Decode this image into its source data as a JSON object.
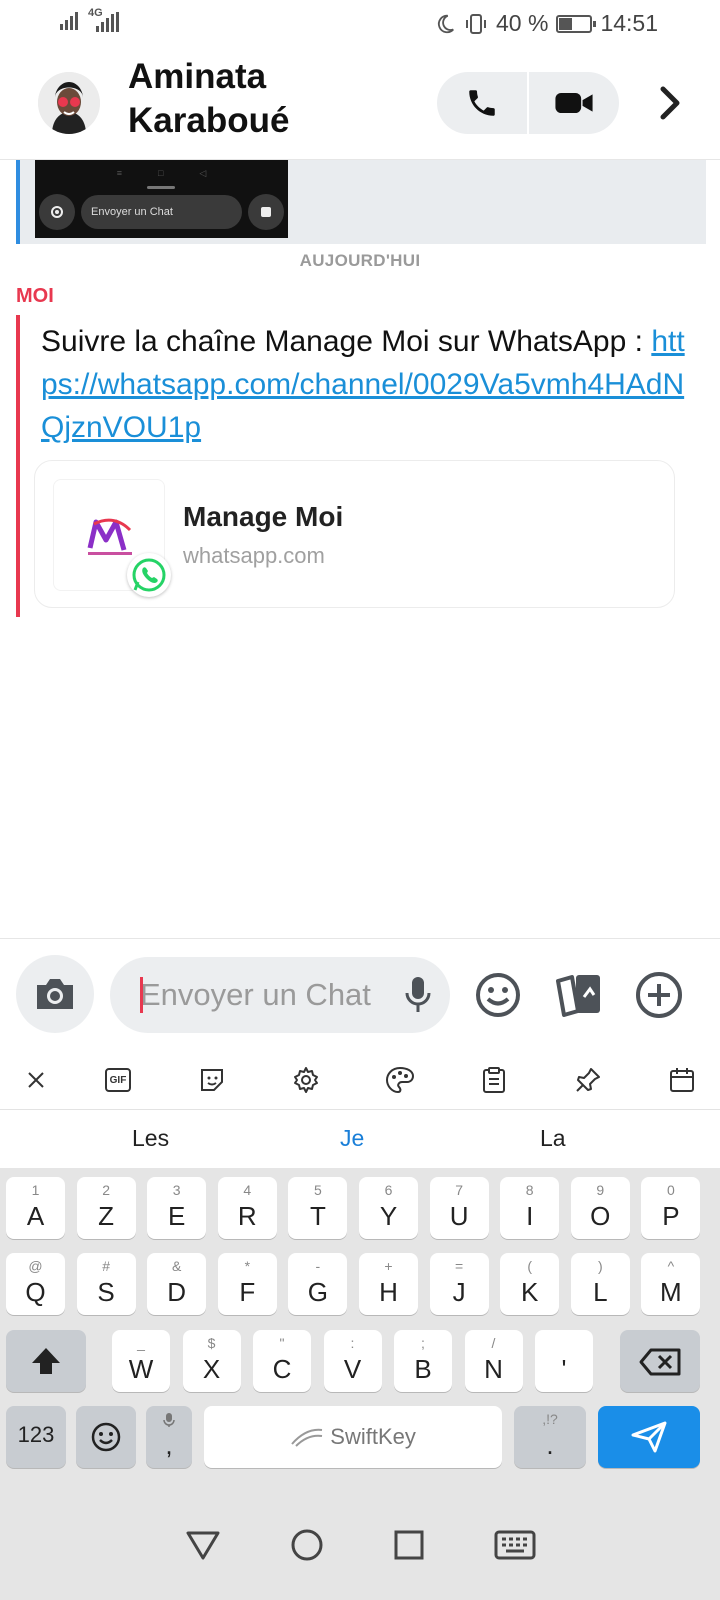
{
  "status_bar": {
    "network": "4G",
    "battery": "40 %",
    "battery_level": 0.4,
    "time": "14:51"
  },
  "header": {
    "contact_name": "Aminata Karaboué",
    "icons": [
      "phone-icon",
      "video-camera-icon",
      "chevron-right-icon"
    ]
  },
  "conversation": {
    "previous_snap": {
      "preview_input_label": "Envoyer un Chat"
    },
    "date_separator": "AUJOURD'HUI",
    "message": {
      "sender": "MOI",
      "text": "Suivre la chaîne Manage Moi sur WhatsApp  : ",
      "link": "https://whatsapp.com/channel/0029Va5vmh4HAdNQjznVOU1p",
      "preview_card": {
        "title": "Manage Moi",
        "domain": "whatsapp.com"
      }
    }
  },
  "composer": {
    "placeholder": "Envoyer un Chat",
    "icons": [
      "camera-icon",
      "microphone-icon",
      "emoji-icon",
      "cards-icon",
      "plus-icon"
    ]
  },
  "keyboard": {
    "toolbar_icons": [
      "close-icon",
      "gif-icon",
      "sticker-icon",
      "settings-icon",
      "palette-icon",
      "clipboard-icon",
      "pin-icon",
      "calendar-icon"
    ],
    "gif_label": "GIF",
    "suggestions": [
      "Les",
      "Je",
      "La"
    ],
    "row1": [
      [
        "1",
        "A"
      ],
      [
        "2",
        "Z"
      ],
      [
        "3",
        "E"
      ],
      [
        "4",
        "R"
      ],
      [
        "5",
        "T"
      ],
      [
        "6",
        "Y"
      ],
      [
        "7",
        "U"
      ],
      [
        "8",
        "I"
      ],
      [
        "9",
        "O"
      ],
      [
        "0",
        "P"
      ]
    ],
    "row2": [
      [
        "@",
        "Q"
      ],
      [
        "#",
        "S"
      ],
      [
        "&",
        "D"
      ],
      [
        "*",
        "F"
      ],
      [
        "-",
        "G"
      ],
      [
        "+",
        "H"
      ],
      [
        "=",
        "J"
      ],
      [
        "(",
        "K"
      ],
      [
        ")",
        "L"
      ],
      [
        "^",
        "M"
      ]
    ],
    "row3": [
      [
        "_",
        "W"
      ],
      [
        "$",
        "X"
      ],
      [
        "\"",
        "C"
      ],
      [
        ":",
        "V"
      ],
      [
        ";",
        "B"
      ],
      [
        "/",
        "N"
      ],
      [
        "",
        "'"
      ]
    ],
    "numbers_key": "123",
    "comma_key": ",",
    "space_label": "SwiftKey",
    "period_alt": ",!?",
    "period_key": "."
  }
}
